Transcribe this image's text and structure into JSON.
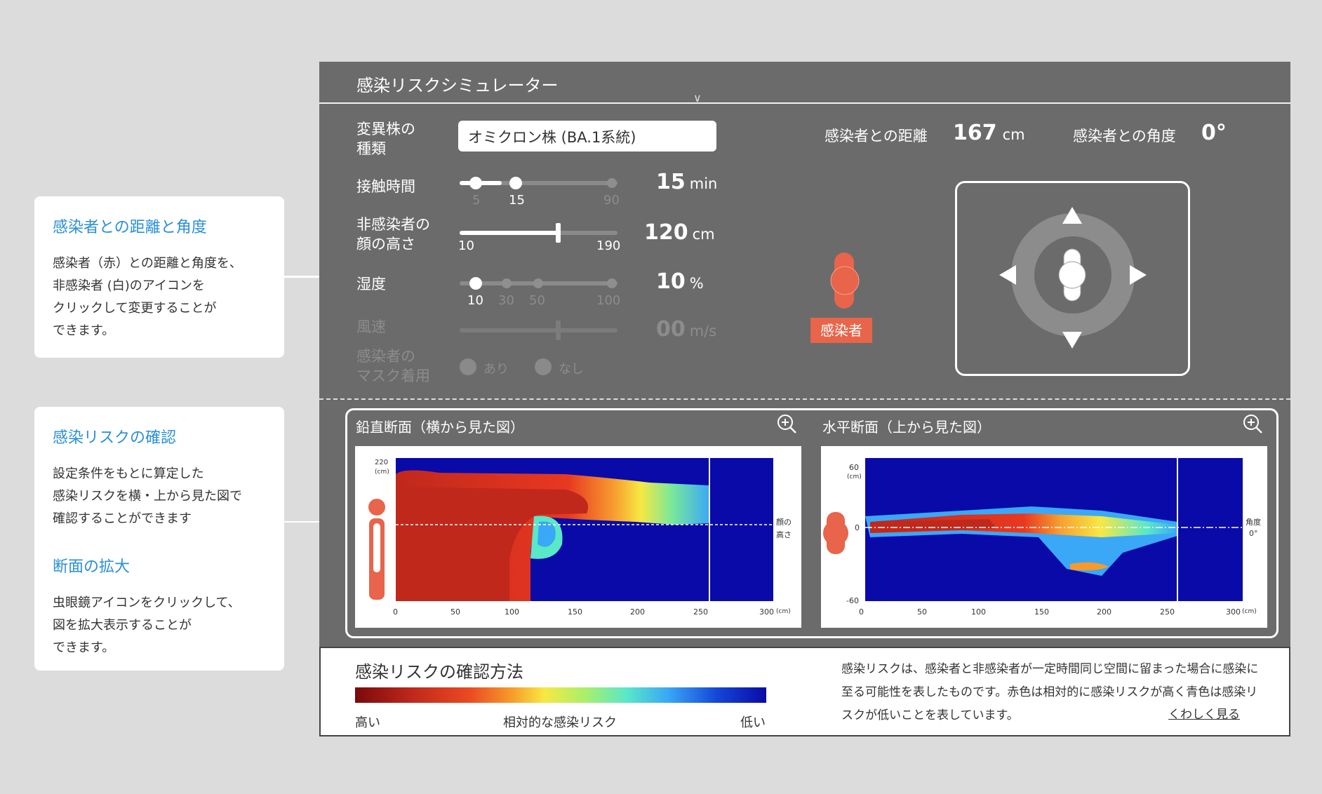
{
  "callouts": {
    "distance": {
      "title": "感染者との距離と角度",
      "body": "感染者（赤）との距離と角度を、\n非感染者 (白)のアイコンを\nクリックして変更することが\nできます。"
    },
    "risk": {
      "title": "感染リスクの確認",
      "body": "設定条件をもとに算定した\n感染リスクを横・上から見た図で\n確認することができます",
      "title2": "断面の拡大",
      "body2": "虫眼鏡アイコンをクリックして、\n図を拡大表示することが\nできます。"
    }
  },
  "simulator": {
    "title": "感染リスクシミュレーター",
    "variant": {
      "label": "変異株の\n種類",
      "value": "オミクロン株 (BA.1系統)"
    },
    "contact_time": {
      "label": "接触時間",
      "min": "5",
      "current": "15",
      "max": "90",
      "value": "15",
      "unit": "min",
      "level": 0.12
    },
    "face_height": {
      "label": "非感染者の\n顔の高さ",
      "min": "10",
      "max": "190",
      "value": "120",
      "unit": "cm",
      "level": 0.61
    },
    "humidity": {
      "label": "湿度",
      "ticks": [
        "10",
        "30",
        "50",
        "100"
      ],
      "value": "10",
      "unit": "%"
    },
    "wind": {
      "label": "風速",
      "value": "00",
      "unit": "m/s"
    },
    "mask": {
      "label": "感染者の\nマスク着用",
      "options": [
        "あり",
        "なし"
      ]
    },
    "distance": {
      "label": "感染者との距離",
      "value": "167",
      "unit": "cm"
    },
    "angle": {
      "label": "感染者との角度",
      "value": "0°"
    },
    "infected_label": "感染者"
  },
  "charts": {
    "vertical": {
      "title": "鉛直断面（横から見た図）",
      "y_top": "220",
      "y_unit": "(cm)",
      "x_ticks": [
        "0",
        "50",
        "100",
        "150",
        "200",
        "250",
        "300"
      ],
      "x_unit": "(cm)",
      "marker_label": [
        "顔の",
        "高さ"
      ]
    },
    "horizontal": {
      "title": "水平断面（上から見た図）",
      "y_top": "60",
      "y_unit": "(cm)",
      "y_mid": "0",
      "y_bottom": "-60",
      "x_ticks": [
        "0",
        "50",
        "100",
        "150",
        "200",
        "250",
        "300"
      ],
      "x_unit": "(cm)",
      "marker_label": [
        "角度",
        "0°"
      ]
    }
  },
  "legend": {
    "title": "感染リスクの確認方法",
    "high": "高い",
    "middle": "相対的な感染リスク",
    "low": "低い",
    "description": "感染リスクは、感染者と非感染者が一定時間同じ空間に留まった場合に感染に至る可能性を表したものです。赤色は相対的に感染リスクが高く青色は感染リスクが低いことを表しています。",
    "more_link": "くわしく見る"
  },
  "colors": {
    "accent": "#2a8fd6",
    "infected": "#e8644a",
    "panel": "#6b6b6b"
  }
}
